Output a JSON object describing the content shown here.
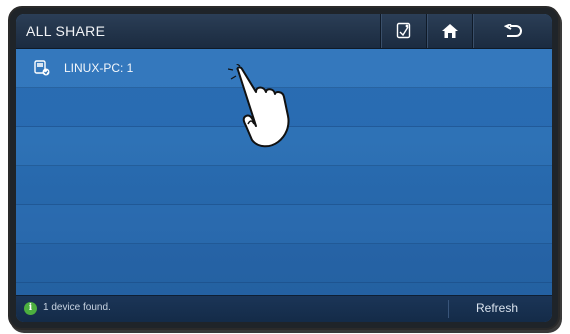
{
  "header": {
    "title": "ALL SHARE",
    "buttons": [
      {
        "icon": "device-info-icon"
      },
      {
        "icon": "home-icon"
      },
      {
        "icon": "back-icon"
      }
    ]
  },
  "devices": [
    {
      "label": "LINUX-PC: 1",
      "icon": "pc-share-icon"
    }
  ],
  "status": {
    "icon": "info-icon",
    "icon_glyph": "i",
    "text": "1 device found.",
    "refresh_label": "Refresh"
  },
  "colors": {
    "accent": "#2b6fb4",
    "titlebar": "#1f3049",
    "status_ok": "#4caf3f"
  }
}
